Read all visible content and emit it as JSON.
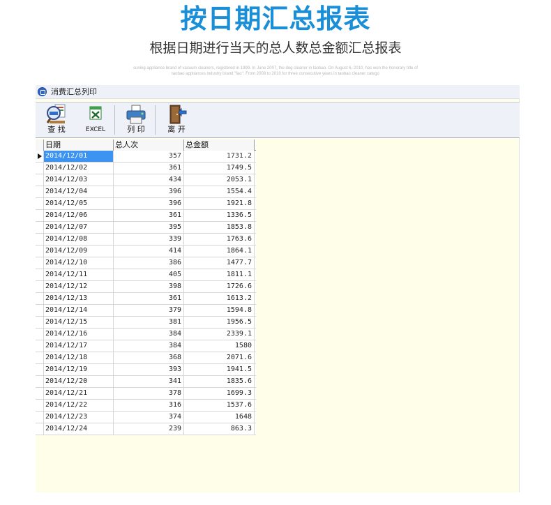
{
  "hero": {
    "title": "按日期汇总报表",
    "subtitle": "根据日期进行当天的总人数总金额汇总报表",
    "blurb": "suning appliance brand of vacuum cleaners, registered in 1999. In June 2007, the dog cleaner in taobao. On August 6, 2010, has won the honorary title of taobao appliances industry brand \"fao\"; From 2008 to 2010 for three consecutive years in taobao cleaner catego"
  },
  "window": {
    "title": "消费汇总列印",
    "icon": "app-icon"
  },
  "toolbar": {
    "search_label": "查 找",
    "excel_label": "EXCEL",
    "print_label": "列 印",
    "exit_label": "离 开",
    "icons": [
      "html-search-icon",
      "excel-icon",
      "printer-icon",
      "door-exit-icon"
    ]
  },
  "table": {
    "columns": [
      "日期",
      "总人次",
      "总金额"
    ],
    "selected_index": 0,
    "rows": [
      {
        "date": "2014/12/01",
        "people": "357",
        "amount": "1731.2"
      },
      {
        "date": "2014/12/02",
        "people": "361",
        "amount": "1749.5"
      },
      {
        "date": "2014/12/03",
        "people": "434",
        "amount": "2053.1"
      },
      {
        "date": "2014/12/04",
        "people": "396",
        "amount": "1554.4"
      },
      {
        "date": "2014/12/05",
        "people": "396",
        "amount": "1921.8"
      },
      {
        "date": "2014/12/06",
        "people": "361",
        "amount": "1336.5"
      },
      {
        "date": "2014/12/07",
        "people": "395",
        "amount": "1853.8"
      },
      {
        "date": "2014/12/08",
        "people": "339",
        "amount": "1763.6"
      },
      {
        "date": "2014/12/09",
        "people": "414",
        "amount": "1864.1"
      },
      {
        "date": "2014/12/10",
        "people": "386",
        "amount": "1477.7"
      },
      {
        "date": "2014/12/11",
        "people": "405",
        "amount": "1811.1"
      },
      {
        "date": "2014/12/12",
        "people": "398",
        "amount": "1726.6"
      },
      {
        "date": "2014/12/13",
        "people": "361",
        "amount": "1613.2"
      },
      {
        "date": "2014/12/14",
        "people": "379",
        "amount": "1594.8"
      },
      {
        "date": "2014/12/15",
        "people": "381",
        "amount": "1956.5"
      },
      {
        "date": "2014/12/16",
        "people": "384",
        "amount": "2339.1"
      },
      {
        "date": "2014/12/17",
        "people": "384",
        "amount": "1580"
      },
      {
        "date": "2014/12/18",
        "people": "368",
        "amount": "2071.6"
      },
      {
        "date": "2014/12/19",
        "people": "393",
        "amount": "1941.5"
      },
      {
        "date": "2014/12/20",
        "people": "341",
        "amount": "1835.6"
      },
      {
        "date": "2014/12/21",
        "people": "378",
        "amount": "1699.3"
      },
      {
        "date": "2014/12/22",
        "people": "316",
        "amount": "1537.6"
      },
      {
        "date": "2014/12/23",
        "people": "374",
        "amount": "1648"
      },
      {
        "date": "2014/12/24",
        "people": "239",
        "amount": "863.3"
      }
    ]
  },
  "colors": {
    "title_blue": "#1a8fd8",
    "selection": "#3d93f2",
    "background": "#ffffe9"
  }
}
